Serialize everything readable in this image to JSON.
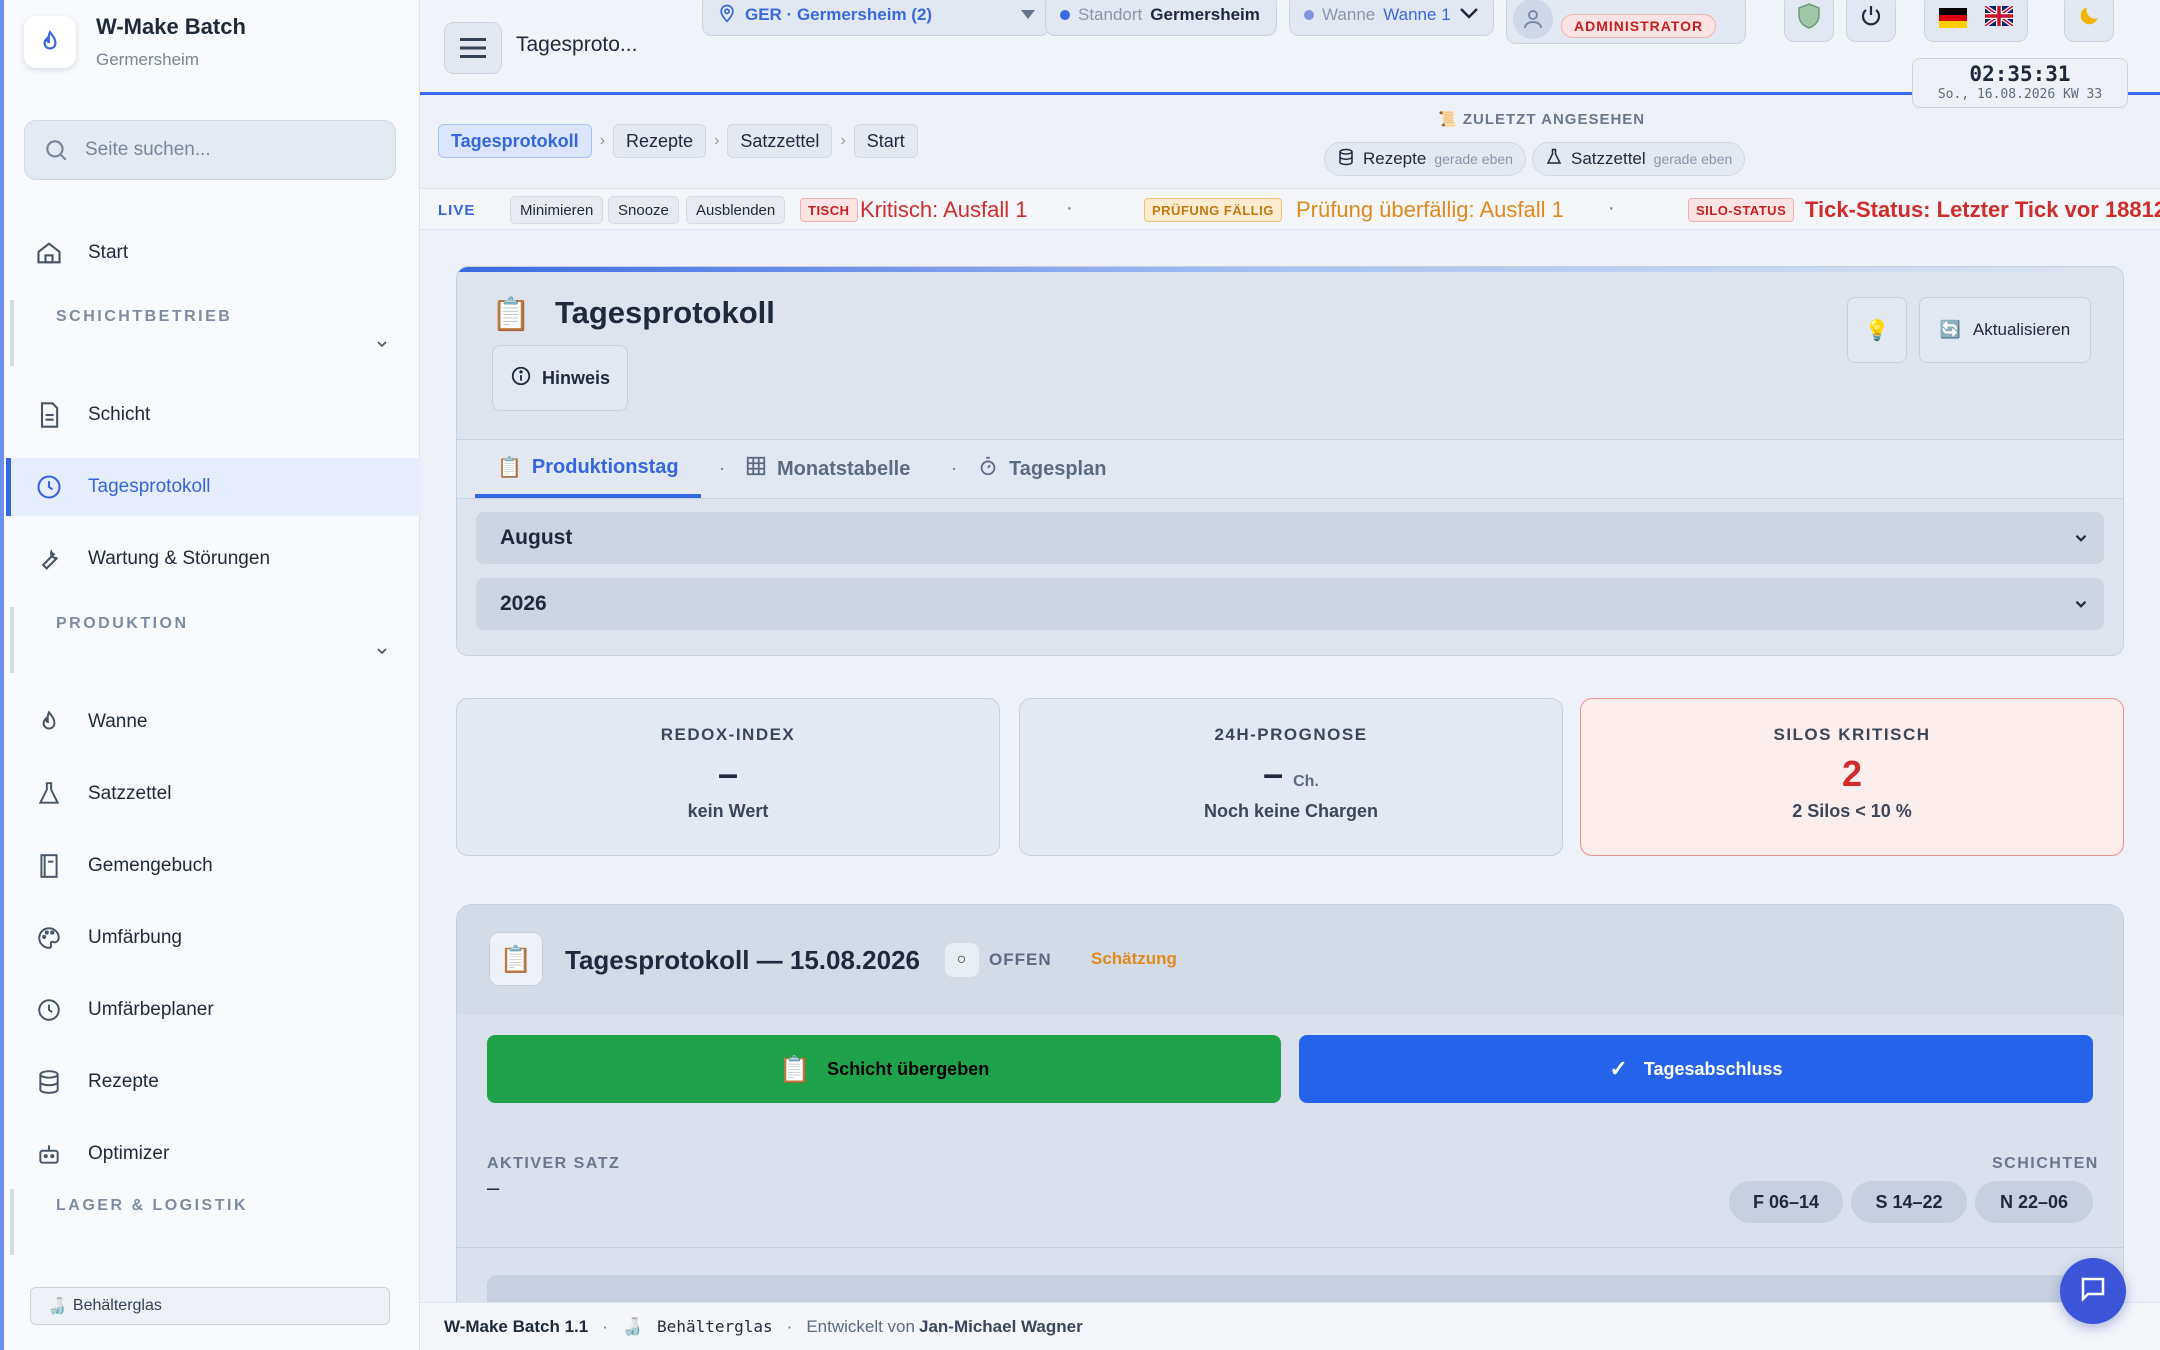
{
  "app": {
    "title": "W-Make Batch",
    "location": "Germersheim"
  },
  "search": {
    "placeholder": "Seite suchen..."
  },
  "sidebar": {
    "start": "Start",
    "section_shift": "SCHICHTBETRIEB",
    "shift": "Schicht",
    "daily_log": "Tagesprotokoll",
    "maintenance": "Wartung & Störungen",
    "section_production": "PRODUKTION",
    "tank": "Wanne",
    "batch_sheet": "Satzzettel",
    "batch_book": "Gemengebuch",
    "recolor": "Umfärbung",
    "recolor_planner": "Umfärbeplaner",
    "recipes": "Rezepte",
    "optimizer": "Optimizer",
    "section_storage": "LAGER & LOGISTIK",
    "footer_item": "Behälterglas"
  },
  "topbar": {
    "page_name": "Tagesproto...",
    "site_select": "GER · Germersheim (2)",
    "location_label": "Standort",
    "location_value": "Germersheim",
    "tank_label": "Wanne",
    "tank_value": "Wanne 1",
    "role_badge": "ADMINISTRATOR",
    "clock_time": "02:35:31",
    "clock_date": "So., 16.08.2026  KW 33"
  },
  "breadcrumbs": [
    "Tagesprotokoll",
    "Rezepte",
    "Satzzettel",
    "Start"
  ],
  "recent": {
    "title": "ZULETZT ANGESEHEN",
    "items": [
      {
        "label": "Rezepte",
        "ago": "gerade eben"
      },
      {
        "label": "Satzzettel",
        "ago": "gerade eben"
      }
    ]
  },
  "ticker": {
    "live": "LIVE",
    "minimize": "Minimieren",
    "snooze": "Snooze",
    "hide": "Ausblenden",
    "tag1": "TISCH",
    "msg1": "Kritisch: Ausfall 1",
    "tag2": "PRÜFUNG FÄLLIG",
    "msg2": "Prüfung überfällig: Ausfall 1",
    "tag3": "SILO-STATUS",
    "msg3": "Tick-Status: Letzter Tick vor 18812",
    "sep": "·"
  },
  "panel": {
    "title": "Tagesprotokoll",
    "hint": "Hinweis",
    "refresh": "Aktualisieren",
    "tabs": [
      "Produktionstag",
      "Monatstabelle",
      "Tagesplan"
    ],
    "month": "August",
    "year": "2026"
  },
  "kpis": [
    {
      "label": "REDOX-INDEX",
      "value": "–",
      "unit": "",
      "sub": "kein Wert"
    },
    {
      "label": "24H-PROGNOSE",
      "value": "–",
      "unit": "Ch.",
      "sub": "Noch keine Chargen"
    },
    {
      "label": "SILOS KRITISCH",
      "value": "2",
      "unit": "",
      "sub": "2 Silos < 10 %"
    }
  ],
  "day": {
    "title": "Tagesprotokoll — 15.08.2026",
    "status_icon": "○",
    "status": "OFFEN",
    "estimate": "Schätzung",
    "handover": "Schicht übergeben",
    "close_day": "Tagesabschluss",
    "active_label": "AKTIVER SATZ",
    "active_value": "–",
    "shifts_label": "SCHICHTEN",
    "shifts": [
      "F 06–14",
      "S 14–22",
      "N 22–06"
    ]
  },
  "footer": {
    "version": "W-Make Batch 1.1",
    "product": "Behälterglas",
    "dev_prefix": "Entwickelt von",
    "author": "Jan-Michael Wagner"
  },
  "colors": {
    "accent": "#3566e0",
    "danger": "#d12c2c",
    "success": "#1fa34a",
    "warning": "#e08a1e"
  }
}
